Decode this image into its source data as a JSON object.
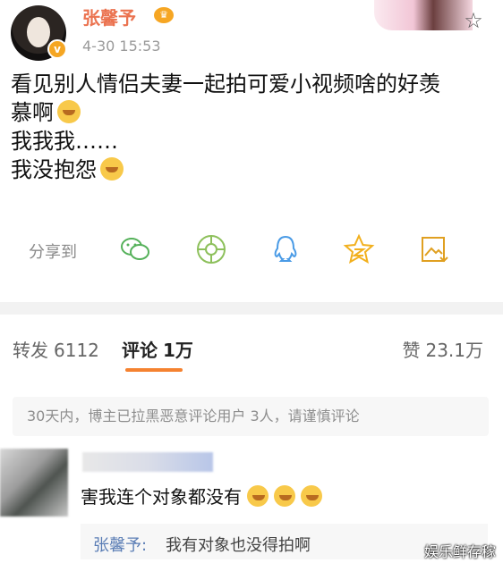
{
  "post": {
    "author": "张馨予",
    "vip_badge": "♛",
    "verified_badge": "v",
    "time": "4-30 15:53",
    "content_lines": [
      "看见别人情侣夫妻一起拍可爱小视频啥的好羡",
      "慕啊",
      "我我我……",
      "我没抱怨"
    ]
  },
  "share": {
    "label": "分享到",
    "icons": [
      "wechat-icon",
      "moments-icon",
      "qq-icon",
      "qzone-icon",
      "save-image-icon"
    ]
  },
  "tabs": {
    "repost_label": "转发",
    "repost_count": "6112",
    "comment_label": "评论",
    "comment_count": "1万",
    "like_label": "赞",
    "like_count": "23.1万"
  },
  "notice": "30天内，博主已拉黑恶意评论用户 3人，请谨慎评论",
  "comment": {
    "text": "害我连个对象都没有",
    "reply_author": "张馨予:",
    "reply_text": "我有对象也没得拍啊"
  },
  "watermark": "娱乐鲜存稼",
  "colors": {
    "author": "#eb7350",
    "accent": "#f58230",
    "reply_link": "#5a7db5"
  }
}
